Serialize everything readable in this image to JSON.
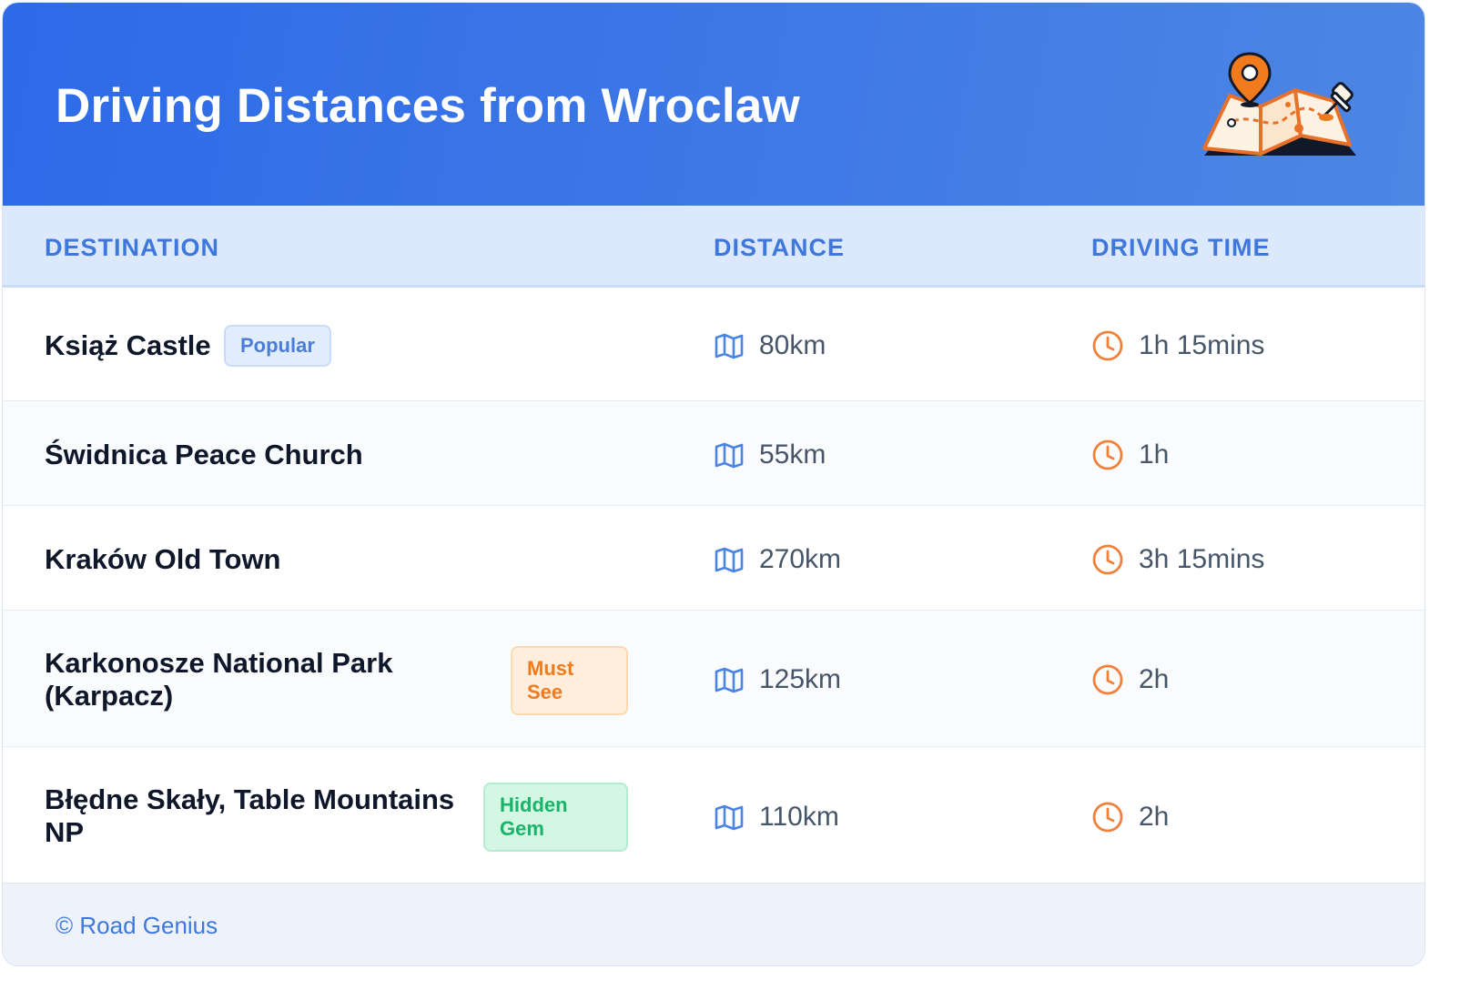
{
  "header": {
    "title": "Driving Distances from Wroclaw"
  },
  "table": {
    "columns": [
      "DESTINATION",
      "DISTANCE",
      "DRIVING TIME"
    ],
    "rows": [
      {
        "destination": "Książ Castle",
        "badge": "Popular",
        "distance": "80km",
        "time": "1h 15mins"
      },
      {
        "destination": "Świdnica Peace Church",
        "badge": "",
        "distance": "55km",
        "time": "1h"
      },
      {
        "destination": "Kraków Old Town",
        "badge": "",
        "distance": "270km",
        "time": "3h 15mins"
      },
      {
        "destination_line1": "Karkonosze National Park",
        "destination_line2": "(Karpacz)",
        "badge_line1": "Must",
        "badge_line2": "See",
        "distance": "125km",
        "time": "2h"
      },
      {
        "destination_line1": "Błędne Skały, Table Mountains",
        "destination_line2": "NP",
        "badge_line1": "Hidden",
        "badge_line2": "Gem",
        "distance": "110km",
        "time": "2h"
      }
    ]
  },
  "icons": {
    "distance": "map-icon",
    "time": "clock-icon",
    "header": "map-pin-illustration"
  },
  "footer": {
    "text": "© Road Genius"
  },
  "colors": {
    "header_blue": "#2d6ae8",
    "accent_blue": "#3f78dc",
    "orange": "#f07a1c",
    "green": "#19b36b"
  }
}
